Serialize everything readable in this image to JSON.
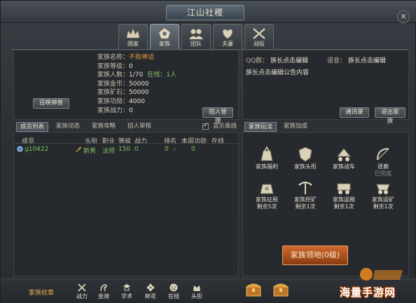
{
  "window": {
    "title": "江山社稷",
    "close_glyph": "×"
  },
  "tabs": [
    {
      "label": "国家",
      "icon": "crown-icon"
    },
    {
      "label": "家族",
      "icon": "family-icon",
      "active": true
    },
    {
      "label": "团队",
      "icon": "team-icon"
    },
    {
      "label": "夫妻",
      "icon": "couple-icon"
    },
    {
      "label": "战役",
      "icon": "battle-icon"
    }
  ],
  "family_info": {
    "rows": [
      {
        "key": "家族名称：",
        "value": "不败神话",
        "highlight": true
      },
      {
        "key": "家族等级：",
        "value": "0"
      },
      {
        "key": "家族人数：",
        "value": "1/70",
        "extra": "在线：1人"
      },
      {
        "key": "家族金币：",
        "value": "50000"
      },
      {
        "key": "家族矿石：",
        "value": "50000"
      },
      {
        "key": "家族功勋：",
        "value": "4000"
      },
      {
        "key": "家族战力：",
        "value": "0"
      }
    ],
    "summon_button": "召唤神兽",
    "recruit_button": "招人管理"
  },
  "notice": {
    "qq_label": "QQ群：",
    "qq_value": "族长点击编辑",
    "voice_label": "语音：",
    "voice_value": "族长点击编辑",
    "announcement": "族长点击编辑公告内容",
    "contacts_button": "通讯录",
    "leave_button": "退出家族"
  },
  "member_tabs": [
    "成员列表",
    "家族动态",
    "家族攻略",
    "招人审核"
  ],
  "show_offline_label": "显示离线",
  "member_table": {
    "headers": [
      "成员",
      "头衔",
      "职业",
      "等级",
      "战力",
      "排名",
      "本周功勋",
      "在线"
    ],
    "rows": [
      {
        "name": "g10422",
        "title": "新秀",
        "class": "法师",
        "level": "150",
        "power": "0",
        "rank": "0",
        "weekly": "–",
        "online": "0"
      }
    ]
  },
  "activity_tabs": [
    "家族玩法",
    "家族加成"
  ],
  "activities": [
    {
      "label": "家族福利",
      "icon": "welfare-bag-icon",
      "sub": ""
    },
    {
      "label": "家族头衔",
      "icon": "title-shield-icon",
      "sub": ""
    },
    {
      "label": "家族战车",
      "icon": "war-chariot-icon",
      "sub": ""
    },
    {
      "label": "逐鹿",
      "icon": "bow-icon",
      "sub": "",
      "status": "已完成"
    },
    {
      "label": "家族征税",
      "icon": "tax-pouch-icon",
      "sub": "剩余5次"
    },
    {
      "label": "家族挖矿",
      "icon": "mining-icon",
      "sub": "剩余1次"
    },
    {
      "label": "家族运粮",
      "icon": "grain-cart-icon",
      "sub": "剩余1次"
    },
    {
      "label": "家族运矿",
      "icon": "ore-cart-icon",
      "sub": "剩余1次"
    }
  ],
  "territory_button": "家族领地(0级)",
  "bottom_bar": {
    "emblem_label": "家族纹章",
    "icons": [
      {
        "label": "战力",
        "icon": "crossed-swords-icon"
      },
      {
        "label": "坐骑",
        "icon": "horse-icon"
      },
      {
        "label": "学术",
        "icon": "scholar-icon"
      },
      {
        "label": "鲜花",
        "icon": "flower-icon"
      },
      {
        "label": "在线",
        "icon": "smile-icon"
      },
      {
        "label": "头衔",
        "icon": "title-icon"
      }
    ],
    "chests": [
      "treasure-chest-icon",
      "treasure-chest-icon"
    ]
  },
  "watermark": {
    "text": "海量手游网",
    "icon": "site-logo-icon"
  },
  "colors": {
    "highlight": "#e6993a",
    "online_green": "#7fc45a",
    "territory_button": "#c0602a",
    "emblem_gold": "#e0b24a"
  }
}
